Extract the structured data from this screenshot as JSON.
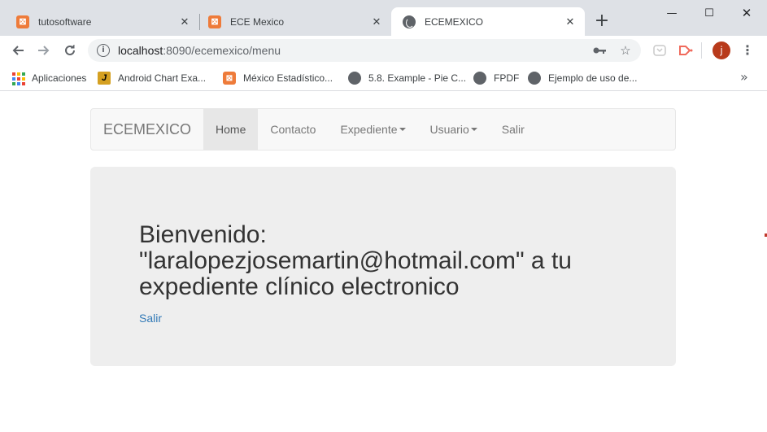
{
  "browser": {
    "tabs": [
      {
        "title": "tutosoftware",
        "icon": "xampp-icon"
      },
      {
        "title": "ECE Mexico",
        "icon": "xampp-icon"
      },
      {
        "title": "ECEMEXICO",
        "icon": "globe-icon",
        "active": true
      }
    ],
    "new_tab": "+",
    "window_controls": {
      "minimize": "—",
      "maximize": "☐",
      "close": "✕"
    },
    "url_host": "localhost",
    "url_path": ":8090/ecemexico/menu",
    "avatar_letter": "j",
    "bookmarks": [
      {
        "label": "Aplicaciones",
        "icon": "apps-grid-icon"
      },
      {
        "label": "Android Chart Exa...",
        "icon": "android-chart-icon"
      },
      {
        "label": "México Estadístico...",
        "icon": "xampp-icon"
      },
      {
        "label": "5.8. Example - Pie C...",
        "icon": "globe-icon"
      },
      {
        "label": "FPDF",
        "icon": "globe-icon"
      },
      {
        "label": "Ejemplo de uso de...",
        "icon": "globe-icon"
      }
    ],
    "bookmarks_more": "»"
  },
  "navbar": {
    "brand": "ECEMEXICO",
    "items": [
      {
        "label": "Home",
        "active": true
      },
      {
        "label": "Contacto"
      },
      {
        "label": "Expediente",
        "dropdown": true
      },
      {
        "label": "Usuario",
        "dropdown": true
      },
      {
        "label": "Salir"
      }
    ]
  },
  "jumbotron": {
    "welcome_line1": "Bienvenido:",
    "welcome_line2": "\"laralopezjosemartin@hotmail.com\" a tu",
    "welcome_line3": "expediente clínico electronico",
    "logout_link": "Salir"
  },
  "colors": {
    "link": "#337ab7",
    "navbar_bg": "#f8f8f8",
    "jumbotron_bg": "#eeeeee",
    "avatar": "#b83a1b"
  }
}
